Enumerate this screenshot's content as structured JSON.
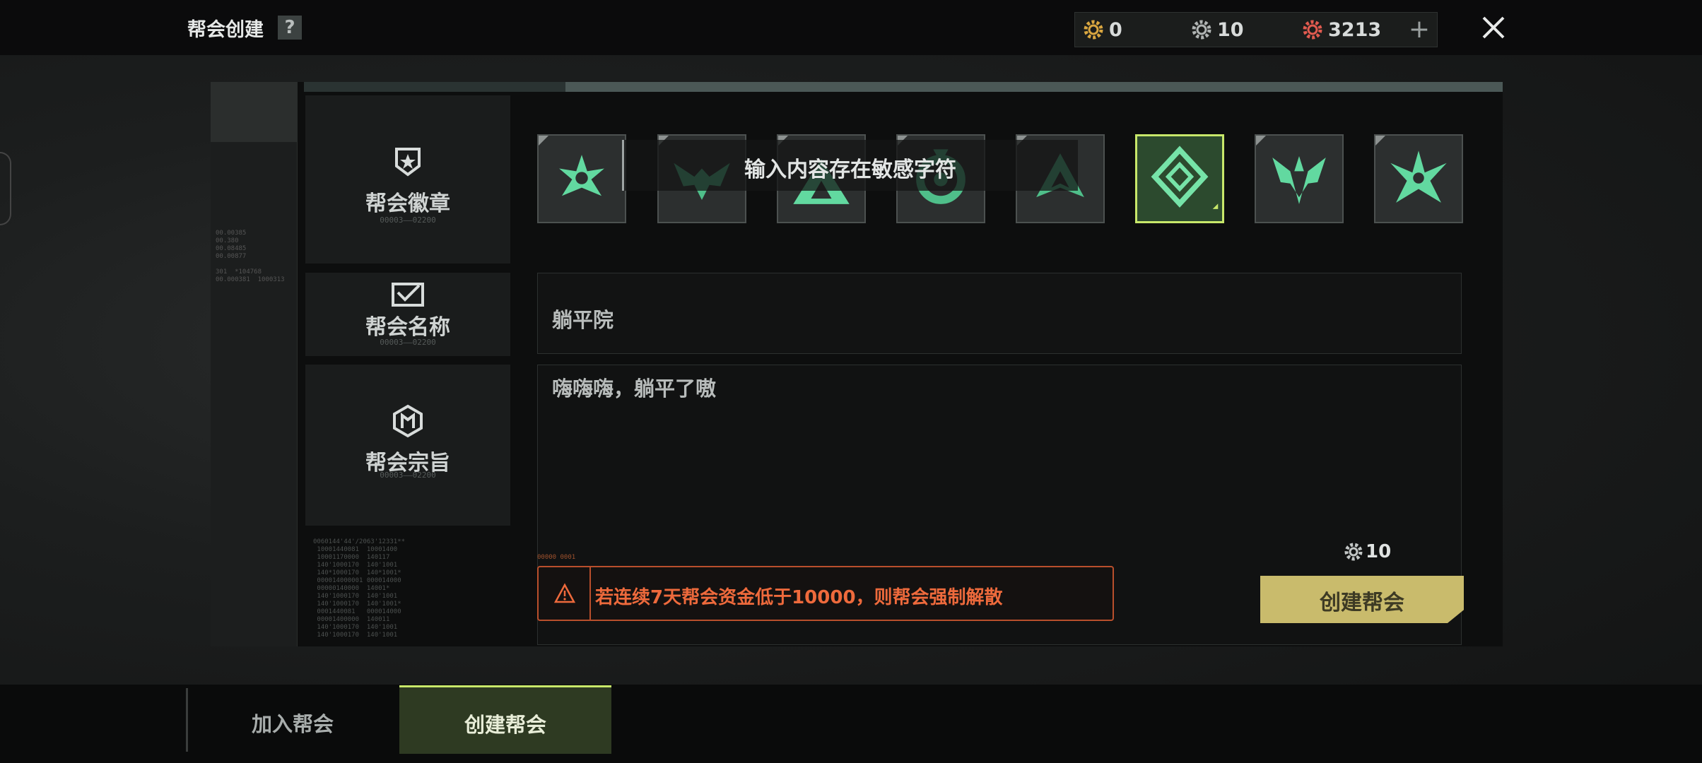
{
  "header": {
    "title": "帮会创建",
    "help_label": "?",
    "currencies": [
      {
        "name": "gold-gear",
        "value": "0",
        "color": "#d9a640"
      },
      {
        "name": "silver-gear",
        "value": "10",
        "color": "#b0b4b3"
      },
      {
        "name": "red-gear",
        "value": "3213",
        "color": "#e05a4f"
      }
    ],
    "add_label": "+",
    "close_icon": "close-icon"
  },
  "sections": {
    "emblem": {
      "label": "帮会徽章",
      "sub": "00003——02200",
      "icon": "shield-star-icon"
    },
    "name": {
      "label": "帮会名称",
      "sub": "00003——02200",
      "icon": "envelope-icon"
    },
    "purpose": {
      "label": "帮会宗旨",
      "sub": "00003——02200",
      "icon": "hexagon-badge-icon"
    }
  },
  "emblems": [
    {
      "icon": "star-emblem-icon",
      "selected": false
    },
    {
      "icon": "wings-emblem-icon",
      "selected": false
    },
    {
      "icon": "triangle-emblem-icon",
      "selected": false
    },
    {
      "icon": "ring-emblem-icon",
      "selected": false
    },
    {
      "icon": "arrow-emblem-icon",
      "selected": false
    },
    {
      "icon": "diamond-emblem-icon",
      "selected": true
    },
    {
      "icon": "trident-emblem-icon",
      "selected": false
    },
    {
      "icon": "burst-emblem-icon",
      "selected": false
    }
  ],
  "tooltip": "输入内容存在敏感字符",
  "form": {
    "name_value": "躺平院",
    "purpose_value": "嗨嗨嗨，躺平了嗷"
  },
  "warning": {
    "tag": "00000 0001",
    "text": "若连续7天帮会资金低于10000，则帮会强制解散",
    "color": "#ee6a3c"
  },
  "create": {
    "cost": "10",
    "button_label": "创建帮会",
    "accent": "#c9bb6c"
  },
  "tabs": [
    {
      "label": "加入帮会",
      "active": false
    },
    {
      "label": "创建帮会",
      "active": true
    }
  ]
}
